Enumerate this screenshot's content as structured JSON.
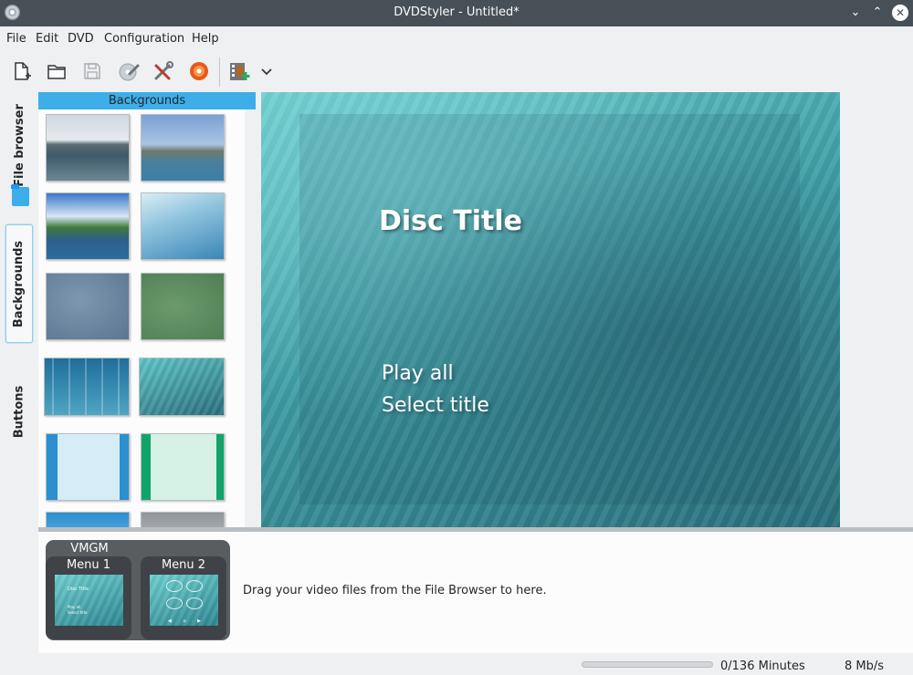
{
  "window": {
    "title": "DVDStyler - Untitled*"
  },
  "menubar": {
    "items": [
      "File",
      "Edit",
      "DVD",
      "Configuration",
      "Help"
    ]
  },
  "toolbar": {
    "buttons": [
      "new-document-icon",
      "open-folder-icon",
      "save-icon",
      "burn-disc-wrench-icon",
      "settings-tools-icon",
      "burn-dvd-icon",
      "add-video-file-icon",
      "dropdown-chevron-icon"
    ]
  },
  "side_tabs": [
    "File browser",
    "Backgrounds",
    "Buttons"
  ],
  "backgrounds_panel": {
    "header": "Backgrounds",
    "thumbnails": [
      "sea-coast",
      "island-ship",
      "lake-shore",
      "blue-light-rays",
      "blue-grey-cloud",
      "green-cloud",
      "blue-stripes",
      "teal-water",
      "light-blue-frame",
      "mint-green-frame",
      "blue-gradient",
      "grey-gradient"
    ]
  },
  "menu_preview": {
    "disc_title": "Disc Title",
    "buttons": [
      "Play all",
      "Select title"
    ]
  },
  "titleset": {
    "vmgm_label": "VMGM",
    "menus": [
      "Menu 1",
      "Menu 2"
    ],
    "menu1_preview": {
      "title": "Disc Title",
      "lines": [
        "Play all",
        "Select title"
      ]
    },
    "drag_hint": "Drag your video files from the File Browser to here."
  },
  "statusbar": {
    "minutes": "0/136 Minutes",
    "rate": "8 Mb/s",
    "progress": 0
  },
  "colors": {
    "accent": "#3daee9",
    "titlebar": "#475057"
  }
}
